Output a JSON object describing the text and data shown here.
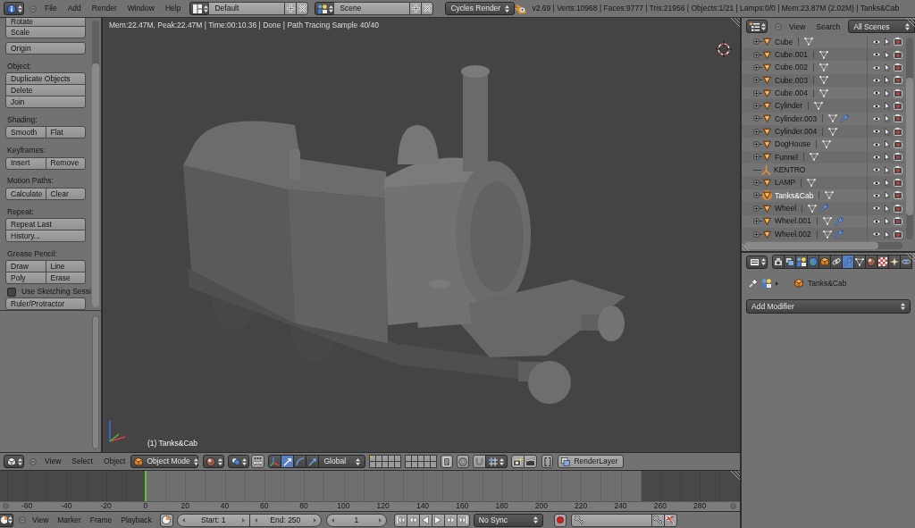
{
  "info_header": {
    "menus": [
      "File",
      "Add",
      "Render",
      "Window",
      "Help"
    ],
    "screen_layout": "Default",
    "scene": "Scene",
    "render_engine": "Cycles Render",
    "stats": "v2.69 | Verts:10968 | Faces:9777 | Tris:21956 | Objects:1/21 | Lamps:0/0 | Mem:23.87M (2.02M) | Tanks&Cab"
  },
  "tool_shelf": {
    "items": [
      {
        "kind": "buttons",
        "rows": [
          [
            "Rotate"
          ],
          [
            "Scale"
          ]
        ]
      },
      {
        "kind": "buttons",
        "rows": [
          [
            "Origin"
          ]
        ]
      },
      {
        "kind": "heading",
        "text": "Object:"
      },
      {
        "kind": "buttons",
        "rows": [
          [
            "Duplicate Objects"
          ],
          [
            "Delete"
          ],
          [
            "Join"
          ]
        ]
      },
      {
        "kind": "heading",
        "text": "Shading:"
      },
      {
        "kind": "buttons",
        "rows": [
          [
            "Smooth",
            "Flat"
          ]
        ]
      },
      {
        "kind": "heading",
        "text": "Keyframes:"
      },
      {
        "kind": "buttons",
        "rows": [
          [
            "Insert",
            "Remove"
          ]
        ]
      },
      {
        "kind": "heading",
        "text": "Motion Paths:"
      },
      {
        "kind": "buttons",
        "rows": [
          [
            "Calculate",
            "Clear"
          ]
        ]
      },
      {
        "kind": "heading",
        "text": "Repeat:"
      },
      {
        "kind": "buttons",
        "rows": [
          [
            "Repeat Last"
          ],
          [
            "History..."
          ]
        ]
      },
      {
        "kind": "heading",
        "text": "Grease Pencil:"
      },
      {
        "kind": "buttons",
        "rows": [
          [
            "Draw",
            "Line"
          ],
          [
            "Poly",
            "Erase"
          ]
        ]
      },
      {
        "kind": "checkbox",
        "label": "Use Sketching Sessi",
        "checked": false
      },
      {
        "kind": "buttons",
        "rows": [
          [
            "Ruler/Protractor"
          ]
        ]
      }
    ]
  },
  "viewport": {
    "render_info": "Mem:22.47M, Peak:22.47M | Time:00:10.36 | Done | Path Tracing Sample 40/40",
    "object_label": "(1) Tanks&Cab"
  },
  "viewport_header": {
    "menus": [
      "View",
      "Select",
      "Object"
    ],
    "mode": "Object Mode",
    "manipulators": [
      {
        "kind": "translate",
        "selected": true
      },
      {
        "kind": "rotate",
        "selected": false
      },
      {
        "kind": "scale",
        "selected": false
      }
    ],
    "orientation": "Global",
    "layers": [
      {
        "has_objects": true
      },
      {
        "has_objects": false
      },
      {
        "has_objects": false
      },
      {
        "has_objects": false
      },
      {
        "has_objects": false
      },
      {
        "has_objects": false
      },
      {
        "has_objects": false
      },
      {
        "has_objects": false
      },
      {
        "has_objects": false
      },
      {
        "has_objects": false
      },
      {
        "has_objects": false
      },
      {
        "has_objects": false
      },
      {
        "has_objects": false
      },
      {
        "has_objects": false
      },
      {
        "has_objects": false
      },
      {
        "has_objects": false
      },
      {
        "has_objects": false
      },
      {
        "has_objects": false
      },
      {
        "has_objects": false
      },
      {
        "has_objects": false
      }
    ],
    "render_layer": "RenderLayer"
  },
  "timeline": {
    "ruler": [
      "-60",
      "-40",
      "-20",
      "0",
      "20",
      "40",
      "60",
      "80",
      "100",
      "120",
      "140",
      "160",
      "180",
      "200",
      "220",
      "240",
      "260",
      "280"
    ],
    "menus": [
      "View",
      "Marker",
      "Frame",
      "Playback"
    ],
    "start": "Start: 1",
    "end": "End: 250",
    "current_frame": "1",
    "sync": "No Sync"
  },
  "outliner": {
    "menus": [
      "View",
      "Search"
    ],
    "display": "All Scenes",
    "rows": [
      {
        "name": "Cube",
        "kind": "mesh",
        "modifier": false,
        "selected": false
      },
      {
        "name": "Cube.001",
        "kind": "mesh",
        "modifier": false,
        "selected": false
      },
      {
        "name": "Cube.002",
        "kind": "mesh",
        "modifier": false,
        "selected": false
      },
      {
        "name": "Cube.003",
        "kind": "mesh",
        "modifier": false,
        "selected": false
      },
      {
        "name": "Cube.004",
        "kind": "mesh",
        "modifier": false,
        "selected": false
      },
      {
        "name": "Cylinder",
        "kind": "mesh",
        "modifier": false,
        "selected": false
      },
      {
        "name": "Cylinder.003",
        "kind": "mesh",
        "modifier": true,
        "selected": false
      },
      {
        "name": "Cylinder.004",
        "kind": "mesh",
        "modifier": false,
        "selected": false
      },
      {
        "name": "DogHouse",
        "kind": "mesh",
        "modifier": false,
        "selected": false
      },
      {
        "name": "Funnel",
        "kind": "mesh",
        "modifier": false,
        "selected": false
      },
      {
        "name": "KENTRO",
        "kind": "empty",
        "modifier": false,
        "selected": false
      },
      {
        "name": "LAMP",
        "kind": "mesh",
        "modifier": false,
        "selected": false
      },
      {
        "name": "Tanks&Cab",
        "kind": "mesh",
        "modifier": false,
        "selected": true
      },
      {
        "name": "Wheel",
        "kind": "mesh",
        "modifier": true,
        "selected": false
      },
      {
        "name": "Wheel.001",
        "kind": "mesh",
        "modifier": true,
        "selected": false
      },
      {
        "name": "Wheel.002",
        "kind": "mesh",
        "modifier": true,
        "selected": false
      }
    ]
  },
  "properties": {
    "tabs": [
      {
        "kind": "render",
        "selected": false
      },
      {
        "kind": "render_layers",
        "selected": false
      },
      {
        "kind": "scene",
        "selected": false
      },
      {
        "kind": "world",
        "selected": false
      },
      {
        "kind": "object",
        "selected": false
      },
      {
        "kind": "constraints",
        "selected": false
      },
      {
        "kind": "modifiers",
        "selected": true
      },
      {
        "kind": "data",
        "selected": false
      },
      {
        "kind": "material",
        "selected": false
      },
      {
        "kind": "texture",
        "selected": false
      },
      {
        "kind": "particles",
        "selected": false
      },
      {
        "kind": "physics",
        "selected": false
      }
    ],
    "object_name": "Tanks&Cab",
    "add_modifier": "Add Modifier"
  }
}
